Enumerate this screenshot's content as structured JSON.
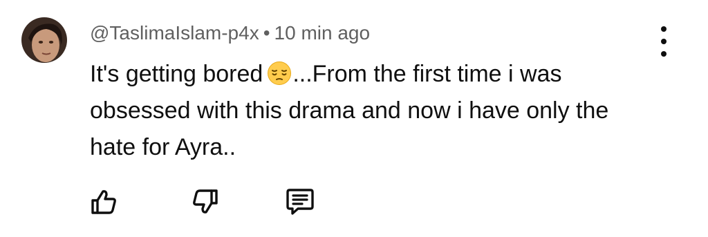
{
  "comment": {
    "author": "@TaslimaIslam-p4x",
    "separator": "•",
    "time": "10 min ago",
    "text_before_emoji": "It's getting bored",
    "emoji": "pensive-face",
    "text_after_emoji": "...From the first time i was obsessed with this drama and now i have only the hate for Ayra..",
    "avatar_icon": "user-avatar"
  },
  "actions": {
    "like_icon": "thumbs-up-icon",
    "dislike_icon": "thumbs-down-icon",
    "reply_icon": "comment-icon",
    "more_icon": "more-vertical-icon"
  },
  "colors": {
    "meta_text": "#606060",
    "body_text": "#0f0f0f",
    "background": "#ffffff"
  }
}
